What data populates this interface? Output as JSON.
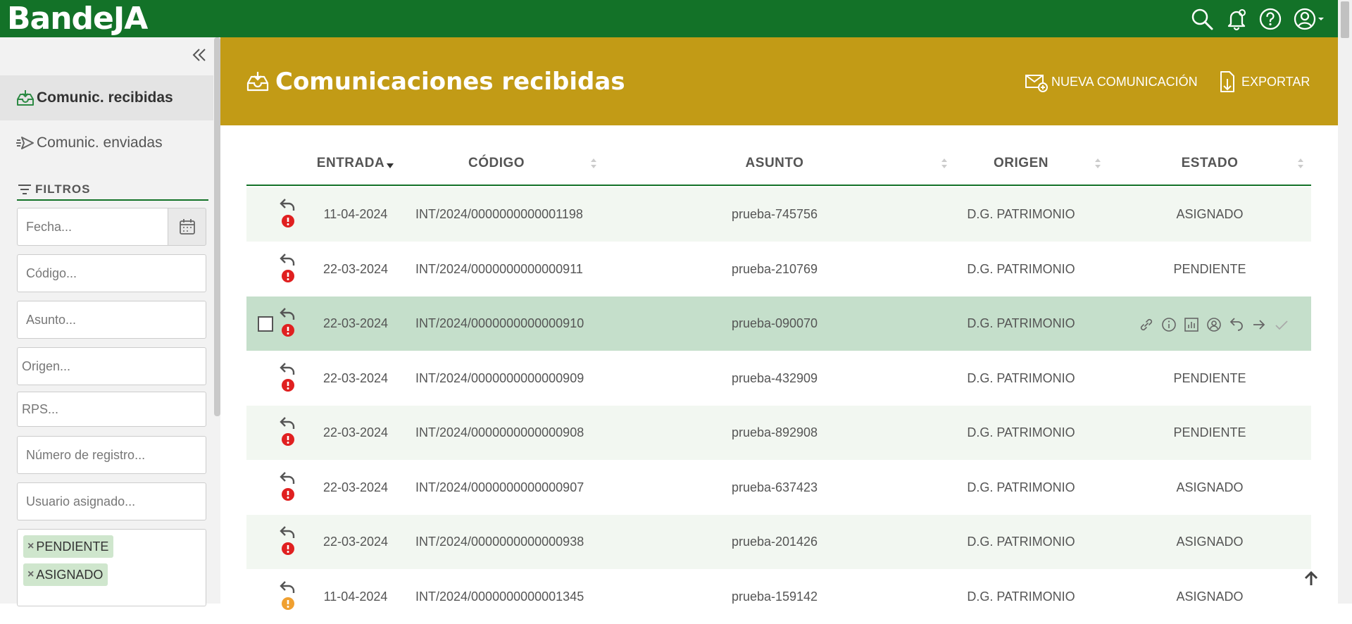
{
  "app": {
    "brand": "BandeJA",
    "top_icons": [
      "search-icon",
      "bell-alert-icon",
      "help-circle-icon",
      "user-account-icon"
    ]
  },
  "colors": {
    "topbar": "#137228",
    "header": "#c29b16",
    "row_alt": "#f2f7f1",
    "row_selected": "#c5dfcb",
    "tag": "#cfe6cd",
    "alert_red": "#e02020",
    "alert_orange": "#f0a030"
  },
  "sidebar": {
    "nav": [
      {
        "label": "Comunic. recibidas",
        "icon": "inbox-icon",
        "active": true
      },
      {
        "label": "Comunic. enviadas",
        "icon": "send-icon",
        "active": false
      }
    ],
    "filters_title": "FILTROS",
    "filters": {
      "fecha_placeholder": "Fecha...",
      "codigo_placeholder": "Código...",
      "asunto_placeholder": "Asunto...",
      "origen_placeholder": "Origen...",
      "rps_placeholder": "RPS...",
      "registro_placeholder": "Número de registro...",
      "usuario_placeholder": "Usuario asignado...",
      "estado_tags": [
        "PENDIENTE",
        "ASIGNADO"
      ]
    }
  },
  "header": {
    "title": "Comunicaciones recibidas",
    "new_button": "NUEVA COMUNICACIÓN",
    "export_button": "EXPORTAR"
  },
  "table": {
    "columns": [
      "ENTRADA",
      "CÓDIGO",
      "ASUNTO",
      "ORIGEN",
      "ESTADO"
    ],
    "sorted_column": "ENTRADA",
    "rows": [
      {
        "entrada": "11-04-2024",
        "codigo": "INT/2024/0000000000001198",
        "asunto": "prueba-745756",
        "origen": "D.G. PATRIMONIO",
        "estado": "ASIGNADO"
      },
      {
        "entrada": "22-03-2024",
        "codigo": "INT/2024/0000000000000911",
        "asunto": "prueba-210769",
        "origen": "D.G. PATRIMONIO",
        "estado": "PENDIENTE"
      },
      {
        "entrada": "22-03-2024",
        "codigo": "INT/2024/0000000000000910",
        "asunto": "prueba-090070",
        "origen": "D.G. PATRIMONIO",
        "estado": ""
      },
      {
        "entrada": "22-03-2024",
        "codigo": "INT/2024/0000000000000909",
        "asunto": "prueba-432909",
        "origen": "D.G. PATRIMONIO",
        "estado": "PENDIENTE"
      },
      {
        "entrada": "22-03-2024",
        "codigo": "INT/2024/0000000000000908",
        "asunto": "prueba-892908",
        "origen": "D.G. PATRIMONIO",
        "estado": "PENDIENTE"
      },
      {
        "entrada": "22-03-2024",
        "codigo": "INT/2024/0000000000000907",
        "asunto": "prueba-637423",
        "origen": "D.G. PATRIMONIO",
        "estado": "ASIGNADO"
      },
      {
        "entrada": "22-03-2024",
        "codigo": "INT/2024/0000000000000938",
        "asunto": "prueba-201426",
        "origen": "D.G. PATRIMONIO",
        "estado": "ASIGNADO"
      },
      {
        "entrada": "11-04-2024",
        "codigo": "INT/2024/0000000000001345",
        "asunto": "prueba-159142",
        "origen": "D.G. PATRIMONIO",
        "estado": "ASIGNADO"
      }
    ],
    "row_actions": [
      "link-icon",
      "info-icon",
      "chart-icon",
      "assign-user-icon",
      "undo-icon",
      "forward-icon",
      "check-icon"
    ]
  }
}
